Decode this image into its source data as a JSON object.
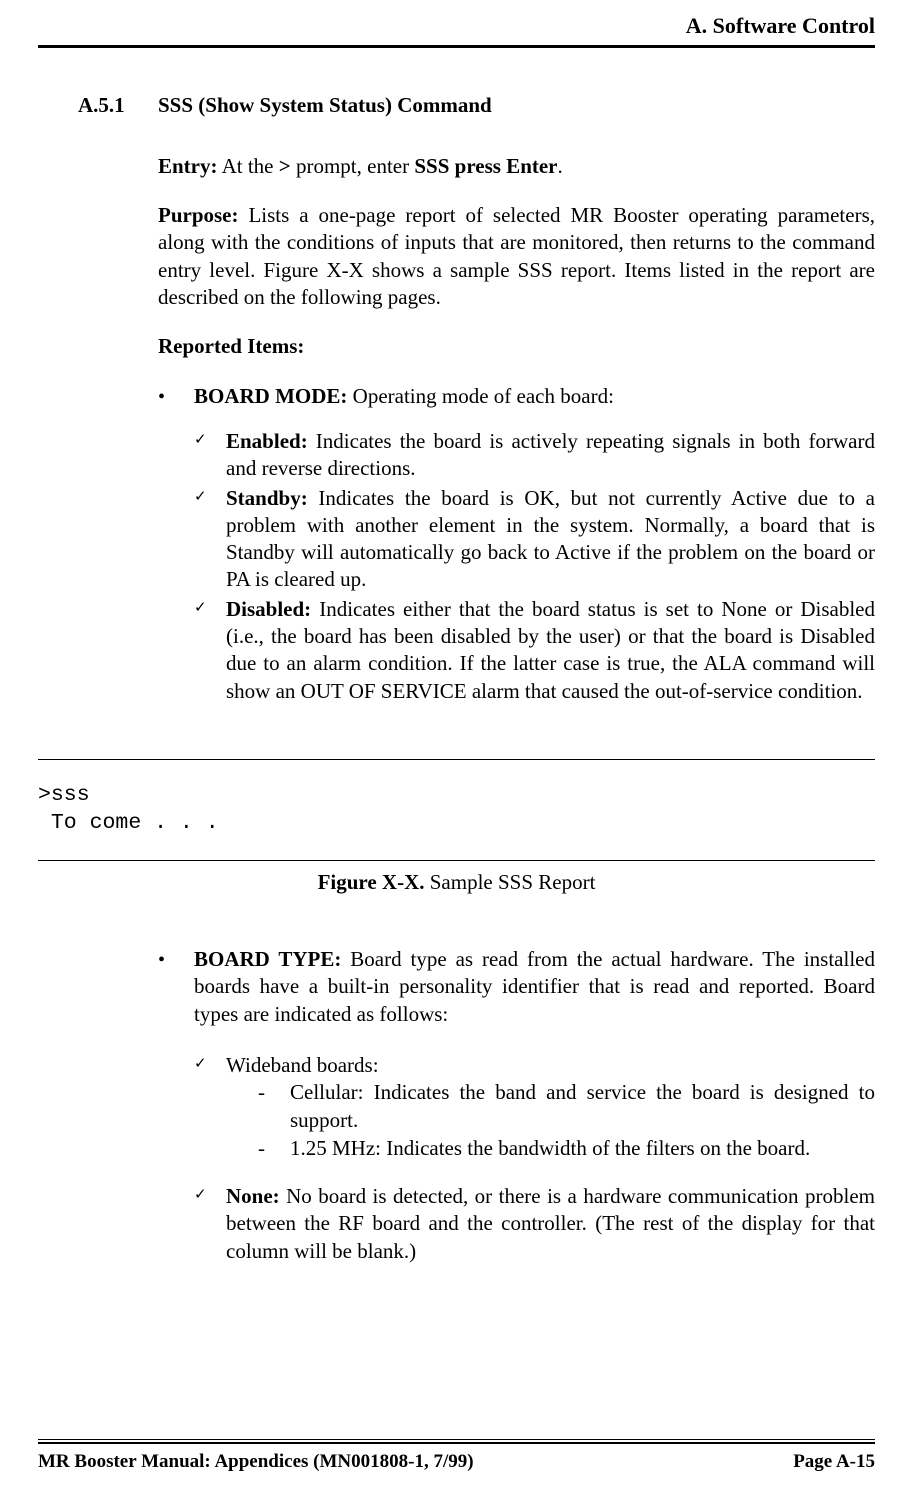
{
  "header": {
    "title": "A. Software Control"
  },
  "section": {
    "number": "A.5.1",
    "title": "SSS (Show System Status) Command"
  },
  "entry": {
    "label": "Entry:",
    "pre": "  At the ",
    "promptChar": ">",
    "mid": " prompt, enter ",
    "cmd": "SSS press Enter",
    "post": "."
  },
  "purpose": {
    "label": "Purpose:",
    "text": "  Lists a one-page report of selected MR Booster operating parameters, along with the conditions of inputs that are monitored, then returns to the command entry level.  Figure X-X shows a sample SSS report.  Items listed in the report are described on the following pages."
  },
  "reportedItemsLabel": "Reported Items:",
  "boardMode": {
    "label": "BOARD MODE:",
    "text": "  Operating mode of each board:",
    "items": {
      "enabled": {
        "label": "Enabled:",
        "text": "  Indicates the board is actively repeating signals in both forward and reverse directions."
      },
      "standby": {
        "label": "Standby:",
        "text": "  Indicates the board is OK, but not currently Active due to a problem with another element in the system. Normally, a board that is Standby will automatically go back to Active if the problem on the board or PA is cleared up."
      },
      "disabled": {
        "label": "Disabled:",
        "text": "  Indicates either that the board status is set to None or Disabled (i.e., the board has been disabled by the user) or that the board is Disabled due to an alarm condition.  If the latter case is true, the ALA command will show an OUT OF SERVICE alarm that caused the out-of-service condition."
      }
    }
  },
  "figure": {
    "terminal": ">sss\n To come . . .",
    "captionBold": "Figure X-X.",
    "captionRest": "  Sample SSS Report"
  },
  "boardType": {
    "label": "BOARD TYPE:",
    "text": "  Board type as read from the actual hardware.  The installed boards have a built-in personality identifier that is read and reported.  Board types are indicated as follows:",
    "wideband": {
      "label": "Wideband boards:",
      "cellular": "Cellular:  Indicates the band and service the board is designed to support.",
      "mhz": "1.25 MHz:  Indicates the bandwidth of the filters on the board."
    },
    "none": {
      "label": "None:",
      "text": " No board is detected, or there is a hardware communication problem between the RF board and the controller.  (The rest of the display for that column will be blank.)"
    }
  },
  "footer": {
    "left": "MR Booster Manual: Appendices (MN001808-1, 7/99)",
    "right": "Page A-15"
  }
}
